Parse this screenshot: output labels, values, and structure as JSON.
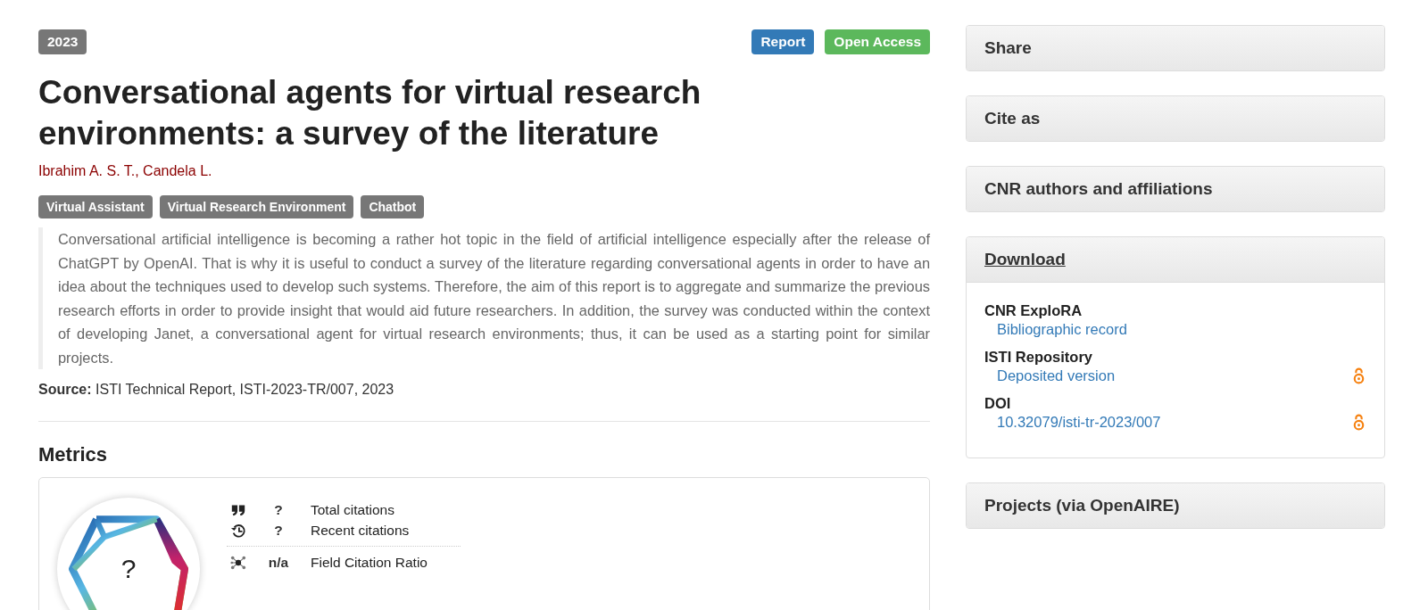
{
  "year": "2023",
  "type_badges": [
    {
      "label": "Report",
      "color": "#337ab7"
    },
    {
      "label": "Open Access",
      "color": "#5cb85c"
    }
  ],
  "title": "Conversational agents for virtual research environments: a survey of the literature",
  "authors": "Ibrahim A. S. T., Candela L.",
  "keywords": [
    "Virtual Assistant",
    "Virtual Research Environment",
    "Chatbot"
  ],
  "abstract": "Conversational artificial intelligence is becoming a rather hot topic in the field of artificial intelligence especially after the release of ChatGPT by OpenAI. That is why it is useful to conduct a survey of the literature regarding conversational agents in order to have an idea about the techniques used to develop such systems. Therefore, the aim of this report is to aggregate and summarize the previous research efforts in order to provide insight that would aid future researchers. In addition, the survey was conducted within the context of developing Janet, a conversational agent for virtual research environments; thus, it can be used as a starting point for similar projects.",
  "source": "**Source:** ISTI Technical Report, ISTI-2023-TR/007, 2023",
  "metrics": {
    "heading": "Metrics",
    "badge_value": "?",
    "rows": [
      {
        "kind": "quote",
        "value": "?",
        "label": "Total citations"
      },
      {
        "kind": "history",
        "value": "?",
        "label": "Recent citations"
      },
      {
        "kind": "network",
        "value": "n/a",
        "label": "Field Citation Ratio"
      }
    ]
  },
  "panels": [
    {
      "title": "Share",
      "expanded": false
    },
    {
      "title": "Cite as",
      "expanded": false
    },
    {
      "title": "CNR authors and affiliations",
      "expanded": false
    },
    {
      "title": "Download",
      "expanded": true,
      "groups": [
        {
          "heading": "CNR ExploRA",
          "link": "Bibliographic record",
          "open_access": false
        },
        {
          "heading": "ISTI Repository",
          "link": "Deposited version",
          "open_access": true
        },
        {
          "heading": "DOI",
          "link": "10.32079/isti-tr-2023/007",
          "open_access": true
        }
      ]
    },
    {
      "title": "Projects (via OpenAIRE)",
      "expanded": false
    }
  ]
}
